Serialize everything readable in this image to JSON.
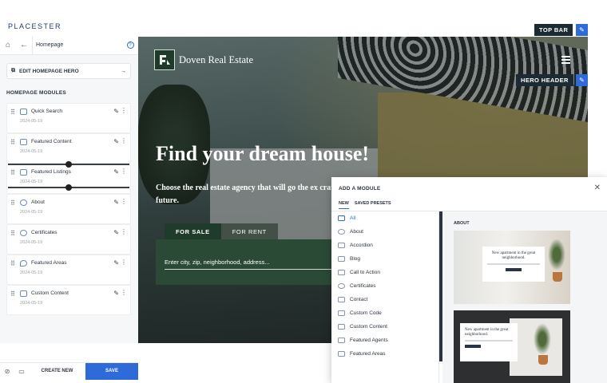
{
  "brand": "PLACESTER",
  "sidebar": {
    "page_title": "Homepage",
    "edit_hero_label": "EDIT HOMEPAGE HERO",
    "section_label": "HOMEPAGE MODULES",
    "modules": [
      {
        "name": "Quick Search",
        "date": "2024-05-19"
      },
      {
        "name": "Featured Content",
        "date": "2024-05-19"
      },
      {
        "name": "Featured Listings",
        "date": "2024-05-19"
      },
      {
        "name": "About",
        "date": "2024-05-19"
      },
      {
        "name": "Certificates",
        "date": "2024-05-19"
      },
      {
        "name": "Featured Areas",
        "date": "2024-05-19"
      },
      {
        "name": "Custom Content",
        "date": "2024-05-19"
      }
    ],
    "slider_level": 0.5,
    "create_new_label": "CREATE NEW",
    "save_label": "SAVE"
  },
  "preview": {
    "site_name": "Doven Real Estate",
    "hero_title": "Find your dream house!",
    "hero_subtitle": "Choose the real estate agency that will go the ex craft your future.",
    "tab_for_sale": "FOR SALE",
    "tab_for_rent": "FOR RENT",
    "search_placeholder": "Enter city, zip, neighborhood, address..."
  },
  "tags": {
    "top_bar": "TOP BAR",
    "hero_header": "HERO HEADER"
  },
  "modal": {
    "title": "ADD A MODULE",
    "tabs": [
      "NEW",
      "SAVED PRESETS"
    ],
    "items": [
      "All",
      "About",
      "Accordion",
      "Blog",
      "Call to Action",
      "Certificates",
      "Contact",
      "Custom Code",
      "Custom Content",
      "Featured Agents",
      "Featured Areas"
    ],
    "selected_item": "All",
    "preview_label": "ABOUT",
    "thumb_text": "New apartment in the great neighborhood."
  },
  "colors": {
    "accent": "#2f6bd8",
    "hero_green": "#1e3b2b",
    "tag_dark": "#1c2a33"
  }
}
